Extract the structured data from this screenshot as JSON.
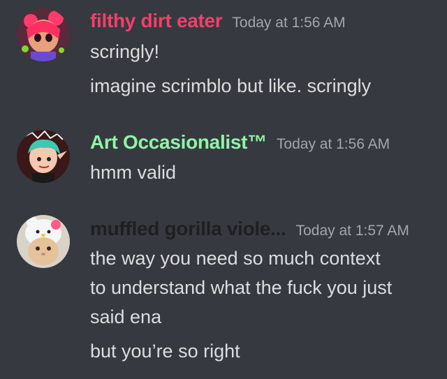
{
  "messages": [
    {
      "username": "filthy dirt eater",
      "username_color": "#f23f6c",
      "timestamp": "Today at 1:56 AM",
      "avatar": "pink-octoling-avatar",
      "lines": [
        "scringly!",
        "imagine scrimblo but like. scringly"
      ]
    },
    {
      "username": "Art Occasionalist™",
      "username_color": "#8ef5a6",
      "timestamp": "Today at 1:56 AM",
      "avatar": "teal-hair-character-avatar",
      "lines": [
        "hmm valid"
      ]
    },
    {
      "username": "muffled gorilla viole...",
      "username_color": "#1e1f22",
      "timestamp": "Today at 1:57 AM",
      "avatar": "cat-in-hello-kitty-hat-avatar",
      "lines": [
        "the way you need so much context",
        "to understand what the fuck you just",
        "said ena",
        "but you’re so right"
      ]
    }
  ]
}
